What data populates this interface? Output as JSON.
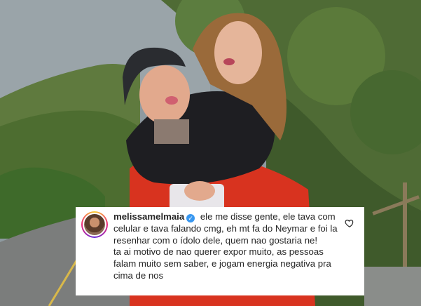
{
  "comment": {
    "username": "melissamelmaia",
    "verified_icon": "verified-badge-icon",
    "text": "ele me disse gente, ele tava com celular e tava falando cmg, eh mt fa do Neymar e foi la resenhar com o ídolo dele, quem nao gostaria ne!\nta ai motivo de nao querer expor muito, as pessoas falam muito sem saber, e jogam energia negativa pra cima de nos",
    "like_icon": "heart-icon"
  },
  "colors": {
    "verified": "#3897f0",
    "text": "#262626",
    "card_bg": "#ffffff"
  }
}
